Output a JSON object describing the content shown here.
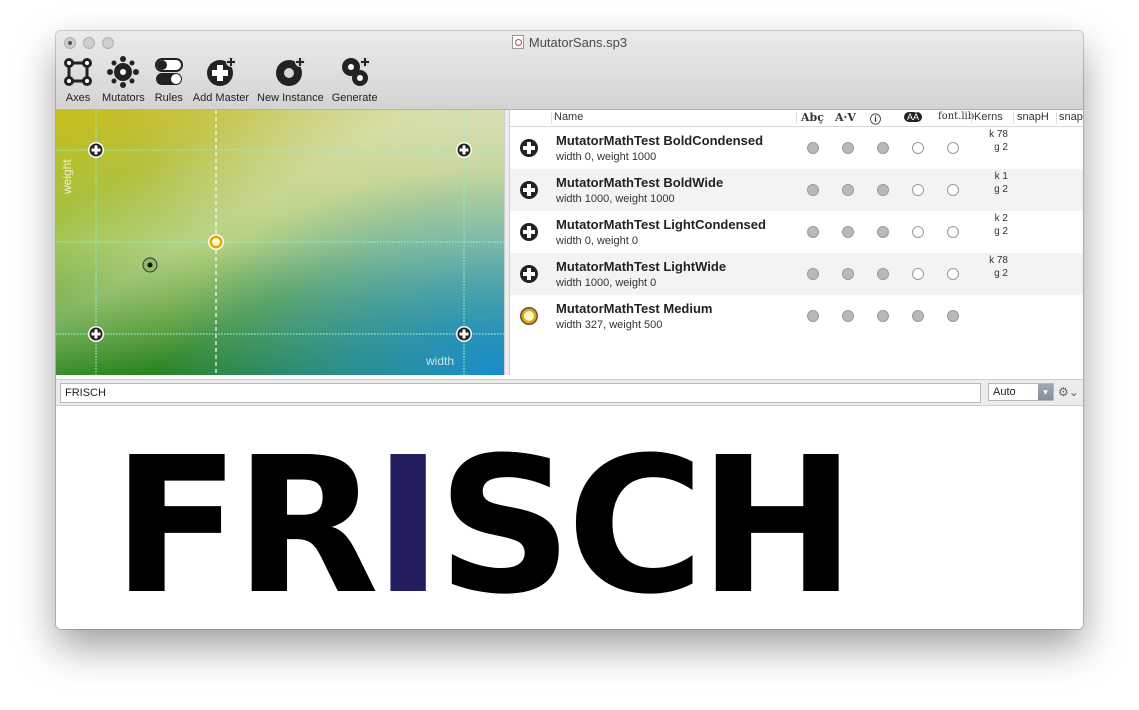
{
  "window": {
    "title": "MutatorSans.sp3"
  },
  "toolbar": [
    {
      "label": "Axes",
      "icon": "axes-icon"
    },
    {
      "label": "Mutators",
      "icon": "mutators-icon"
    },
    {
      "label": "Rules",
      "icon": "rules-icon"
    },
    {
      "label": "Add Master",
      "icon": "add-master-icon"
    },
    {
      "label": "New Instance",
      "icon": "new-instance-icon"
    },
    {
      "label": "Generate",
      "icon": "generate-icon"
    }
  ],
  "designspace": {
    "axis_x": "width",
    "axis_y": "weight"
  },
  "table": {
    "columns": [
      "Name",
      "Abç",
      "A·V",
      "ⓘ",
      "AÄ",
      "font.lib",
      "Kerns",
      "snapH",
      "snap"
    ],
    "rows": [
      {
        "name": "MutatorMathTest BoldCondensed",
        "location": "width 0, weight 1000",
        "icon": "master-plus-icon",
        "flags": [
          1,
          1,
          1,
          0,
          0
        ],
        "kerns": [
          "k 78",
          "g 2"
        ]
      },
      {
        "name": "MutatorMathTest BoldWide",
        "location": "width 1000, weight 1000",
        "icon": "master-plus-icon",
        "flags": [
          1,
          1,
          1,
          0,
          0
        ],
        "kerns": [
          "k 1",
          "g 2"
        ]
      },
      {
        "name": "MutatorMathTest LightCondensed",
        "location": "width 0, weight 0",
        "icon": "master-plus-icon",
        "flags": [
          1,
          1,
          1,
          0,
          0
        ],
        "kerns": [
          "k 2",
          "g 2"
        ]
      },
      {
        "name": "MutatorMathTest LightWide",
        "location": "width 1000, weight 0",
        "icon": "master-plus-icon",
        "flags": [
          1,
          1,
          1,
          0,
          0
        ],
        "kerns": [
          "k 78",
          "g 2"
        ]
      },
      {
        "name": "MutatorMathTest Medium",
        "location": "width 327, weight 500",
        "icon": "instance-ring-icon",
        "flags": [
          1,
          1,
          1,
          1,
          1
        ],
        "kerns": [
          "",
          ""
        ]
      }
    ]
  },
  "preview": {
    "text": "FRISCH",
    "size": "Auto",
    "glyphs": [
      "F",
      "R",
      "I",
      "S",
      "C",
      "H"
    ],
    "highlight_color": "#231e5f"
  }
}
